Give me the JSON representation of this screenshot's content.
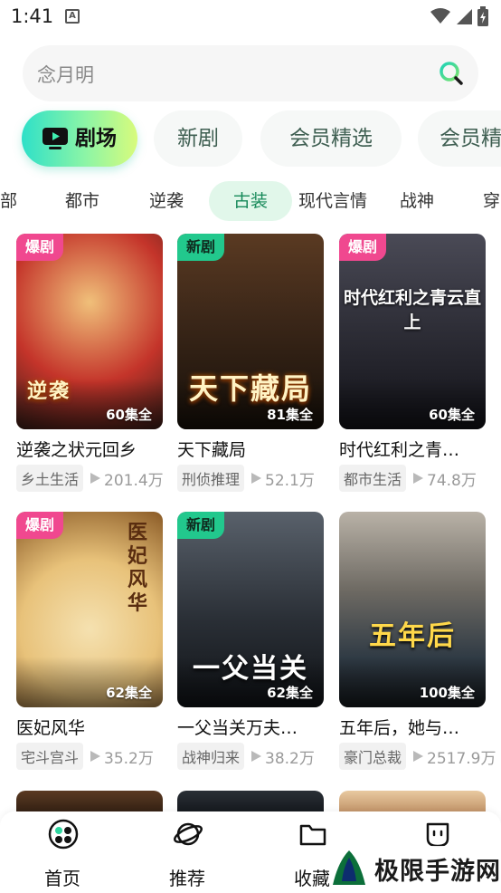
{
  "status_bar": {
    "time": "1:41",
    "notification_letter": "A"
  },
  "search": {
    "placeholder": "念月明"
  },
  "top_tabs": [
    {
      "label": "剧场",
      "active": true,
      "icon": "tv-play-icon"
    },
    {
      "label": "新剧",
      "active": false
    },
    {
      "label": "会员精选",
      "active": false
    },
    {
      "label": "会员精",
      "active": false
    }
  ],
  "categories": [
    {
      "label": "部",
      "active": false
    },
    {
      "label": "都市",
      "active": false
    },
    {
      "label": "逆袭",
      "active": false
    },
    {
      "label": "古装",
      "active": true
    },
    {
      "label": "现代言情",
      "active": false
    },
    {
      "label": "战神",
      "active": false
    },
    {
      "label": "穿",
      "active": false
    }
  ],
  "cards": [
    {
      "badge": "爆剧",
      "badge_type": "hot",
      "episodes": "60集全",
      "title": "逆袭之状元回乡",
      "tag": "乡土生活",
      "views": "201.4万",
      "poster_text": "逆袭",
      "colors": [
        "#c4342a",
        "#e7a067",
        "#3b1e18"
      ]
    },
    {
      "badge": "新剧",
      "badge_type": "new",
      "episodes": "81集全",
      "title": "天下藏局",
      "tag": "刑侦推理",
      "views": "52.1万",
      "poster_text": "天下藏局",
      "colors": [
        "#3a2618",
        "#7d5432",
        "#171009"
      ]
    },
    {
      "badge": "爆剧",
      "badge_type": "hot",
      "episodes": "60集全",
      "title": "时代红利之青…",
      "tag": "都市生活",
      "views": "74.8万",
      "poster_text": "时代红利之青云直上",
      "colors": [
        "#2d2d36",
        "#6e6e7a",
        "#121218"
      ]
    },
    {
      "badge": "爆剧",
      "badge_type": "hot",
      "episodes": "62集全",
      "title": "医妃风华",
      "tag": "宅斗宫斗",
      "views": "35.2万",
      "poster_text": "医妃风华",
      "colors": [
        "#e8c27a",
        "#f5e1b0",
        "#8a5a26"
      ]
    },
    {
      "badge": "新剧",
      "badge_type": "new",
      "episodes": "62集全",
      "title": "一父当关万夫…",
      "tag": "战神归来",
      "views": "38.2万",
      "poster_text": "一父当关",
      "colors": [
        "#2a2f36",
        "#59616b",
        "#101317"
      ]
    },
    {
      "badge": "",
      "badge_type": "",
      "episodes": "100集全",
      "title": "五年后，她与…",
      "tag": "豪门总裁",
      "views": "2517.9万",
      "poster_text": "五年后",
      "colors": [
        "#2f3a44",
        "#b9b2a7",
        "#161a1e"
      ]
    }
  ],
  "bottom_nav": [
    {
      "label": "首页",
      "icon": "home-dots-icon",
      "active": true
    },
    {
      "label": "推荐",
      "icon": "planet-icon",
      "active": false
    },
    {
      "label": "收藏",
      "icon": "folder-icon",
      "active": false
    },
    {
      "label": "",
      "icon": "face-icon",
      "active": false
    }
  ],
  "watermark": {
    "text": "极限手游网"
  },
  "colors": {
    "accent": "#22c88d",
    "hot_badge": "#f0488f",
    "active_category_bg": "#e1f7ea",
    "active_category_text": "#178a5a"
  }
}
